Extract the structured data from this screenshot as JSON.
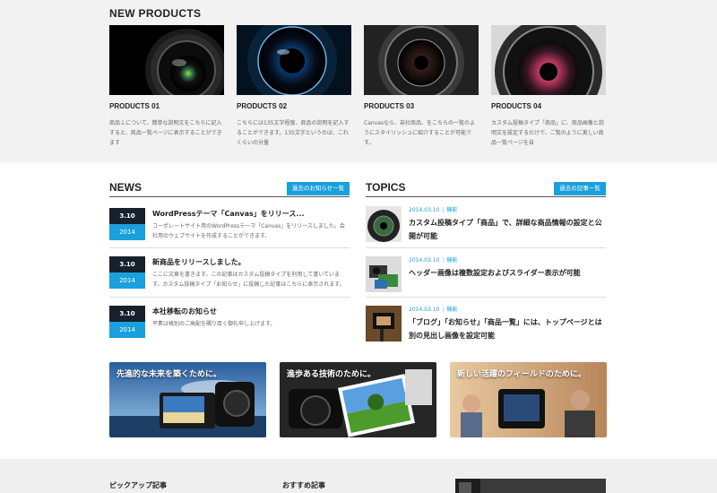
{
  "new_products": {
    "title": "NEW PRODUCTS",
    "items": [
      {
        "name": "PRODUCTS 01",
        "desc": "商品１について、簡単な説明文をこちらに記入すると、商品一覧ページに表示することができます"
      },
      {
        "name": "PRODUCTS 02",
        "desc": "こちらには135文字程度、商品の説明を記入することができます。135文字というのは、これくらいの分量"
      },
      {
        "name": "PRODUCTS 03",
        "desc": "Canvasなら、自社商品、をこちらの一覧のようにスタイリッシュに紹介することが可能です。"
      },
      {
        "name": "PRODUCTS 04",
        "desc": "カスタム投稿タイプ「商品」に、商品画像と説明文を設定するだけで、ご覧のように美しい商品一覧ページを自"
      }
    ]
  },
  "news": {
    "title": "NEWS",
    "archive_label": "過去のお知らせ一覧",
    "items": [
      {
        "md": "3.10",
        "year": "2014",
        "title": "WordPressテーマ「Canvas」をリリース...",
        "body": "コーポレートサイト用のWordPressテーマ「Canvas」をリリースしました。会社用のウェブサイトを作成することができます。"
      },
      {
        "md": "3.10",
        "year": "2014",
        "title": "新商品をリリースしました。",
        "body": "ここに文章を書きます。この記事はカスタム投稿タイプを利用して書いています。カスタム投稿タイプ「お知らせ」に投稿した記事はこちらに表示されます。"
      },
      {
        "md": "3.10",
        "year": "2014",
        "title": "本社移転のお知らせ",
        "body": "平素は格別のご高配を賜り厚く御礼申し上げます。"
      }
    ]
  },
  "topics": {
    "title": "TOPICS",
    "archive_label": "過去の記事一覧",
    "items": [
      {
        "date": "2014.03.10",
        "category": "機能",
        "title": "カスタム投稿タイプ「商品」で、詳細な商品情報の設定と公開が可能"
      },
      {
        "date": "2014.03.10",
        "category": "機能",
        "title": "ヘッダー画像は複数設定およびスライダー表示が可能"
      },
      {
        "date": "2014.03.10",
        "category": "機能",
        "title": "「ブログ」「お知らせ」「商品一覧」には、トップページとは別の見出し画像を設定可能"
      }
    ]
  },
  "banners": [
    {
      "caption": "先進的な未来を築くために。"
    },
    {
      "caption": "進歩ある技術のために。"
    },
    {
      "caption": "新しい活躍のフィールドのために。"
    }
  ],
  "footer": {
    "pickup_title": "ピックアップ記事",
    "recommend_title": "おすすめ記事"
  },
  "colors": {
    "accent": "#1aa0dc",
    "dark": "#17212d",
    "band": "#f2f2f2"
  }
}
